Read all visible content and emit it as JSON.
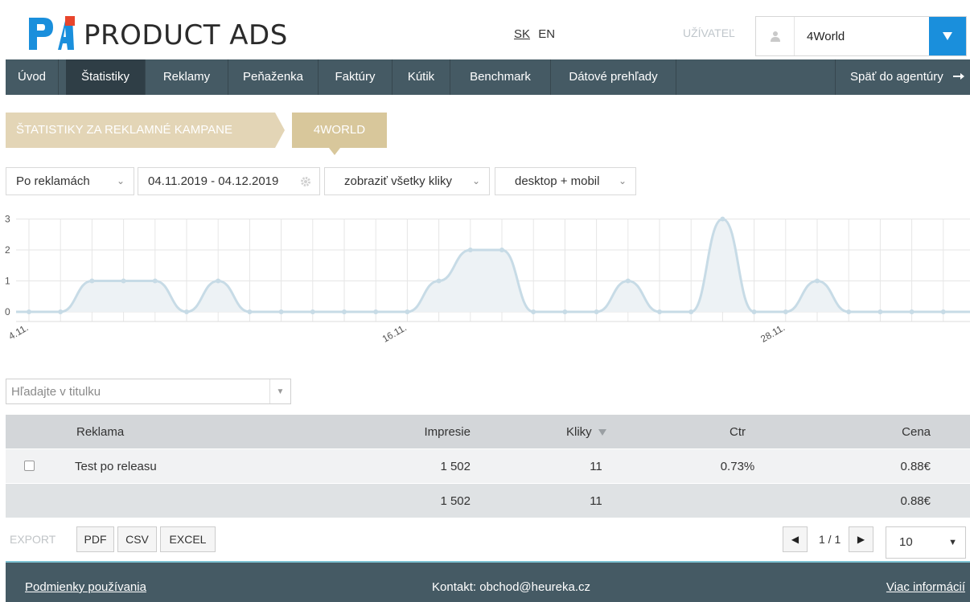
{
  "header": {
    "logo_text": "PRODUCT ADS",
    "lang_sk": "SK",
    "lang_en": "EN",
    "user_label": "UŽÍVATEĽ",
    "user_value": "4World"
  },
  "nav": {
    "items": [
      {
        "label": "Úvod"
      },
      {
        "label": "Štatistiky"
      },
      {
        "label": "Reklamy"
      },
      {
        "label": "Peňaženka"
      },
      {
        "label": "Faktúry"
      },
      {
        "label": "Kútik"
      },
      {
        "label": "Benchmark"
      },
      {
        "label": "Dátové prehľady"
      }
    ],
    "back_label": "Späť do agentúry"
  },
  "breadcrumb": {
    "section": "ŠTATISTIKY ZA REKLAMNÉ KAMPANE",
    "current": "4WORLD"
  },
  "filters": {
    "group_by": "Po reklamách",
    "date_range": "04.11.2019 - 04.12.2019",
    "clicks": "zobraziť všetky kliky",
    "device": "desktop + mobil"
  },
  "chart_data": {
    "type": "area",
    "x_tick_labels": [
      "4.11.",
      "16.11.",
      "28.11."
    ],
    "y_ticks": [
      0,
      1,
      2,
      3
    ],
    "ylim": [
      0,
      3
    ],
    "grid": true,
    "series": [
      {
        "values": [
          0,
          0,
          1,
          1,
          1,
          0,
          1,
          0,
          0,
          0,
          0,
          0,
          0,
          1,
          2,
          2,
          0,
          0,
          0,
          1,
          0,
          0,
          3,
          0,
          0,
          1,
          0,
          0,
          0,
          0,
          0
        ]
      }
    ],
    "colors": {
      "line": "#c7dbe6",
      "fill": "#edf2f5",
      "grid": "#e6e6e6"
    }
  },
  "search": {
    "placeholder": "Hľadajte v titulku"
  },
  "table": {
    "headers": [
      "Reklama",
      "Impresie",
      "Kliky",
      "Ctr",
      "Cena"
    ],
    "rows": [
      {
        "name": "Test po releasu",
        "impresie": "1 502",
        "kliky": "11",
        "ctr": "0.73%",
        "cena": "0.88€"
      }
    ],
    "total": {
      "impresie": "1 502",
      "kliky": "11",
      "cena": "0.88€"
    }
  },
  "export": {
    "label": "EXPORT",
    "pdf": "PDF",
    "csv": "CSV",
    "excel": "EXCEL"
  },
  "pager": {
    "text": "1 / 1",
    "per_page": "10"
  },
  "footer": {
    "terms": "Podmienky používania",
    "contact": "Kontakt: obchod@heureka.cz",
    "more": "Viac informácií"
  }
}
